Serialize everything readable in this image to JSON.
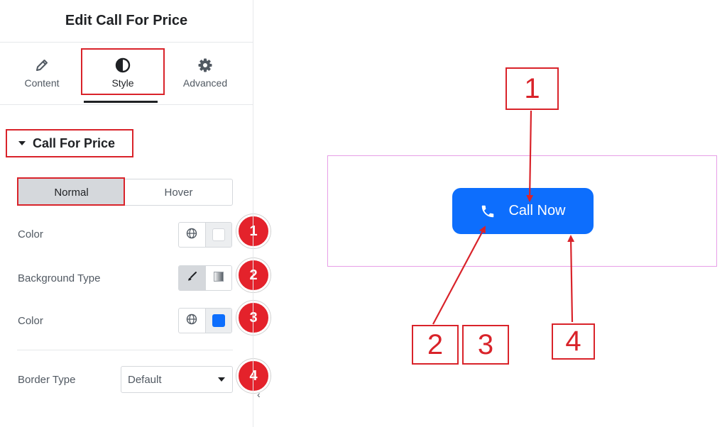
{
  "panel": {
    "title": "Edit Call For Price",
    "tabs": [
      {
        "label": "Content",
        "icon": "pencil-icon"
      },
      {
        "label": "Style",
        "icon": "half-circle-icon"
      },
      {
        "label": "Advanced",
        "icon": "gear-icon"
      }
    ],
    "active_tab": "Style",
    "section_title": "Call For Price",
    "state_toggle": {
      "options": [
        "Normal",
        "Hover"
      ],
      "selected": "Normal"
    },
    "controls": [
      {
        "label": "Color",
        "badge": "1",
        "swatch_color": "#ffffff"
      },
      {
        "label": "Background Type",
        "badge": "2"
      },
      {
        "label": "Color",
        "badge": "3",
        "swatch_color": "#0d6efd"
      },
      {
        "label": "Border Type",
        "badge": "4",
        "value": "Default"
      }
    ],
    "collapse_glyph": "‹"
  },
  "preview": {
    "button_label": "Call Now",
    "button_color": "#0d6efd"
  },
  "callouts": [
    "1",
    "2",
    "3",
    "4"
  ],
  "colors": {
    "annotation_red": "#d9232a",
    "preview_border": "#e79ee7"
  }
}
